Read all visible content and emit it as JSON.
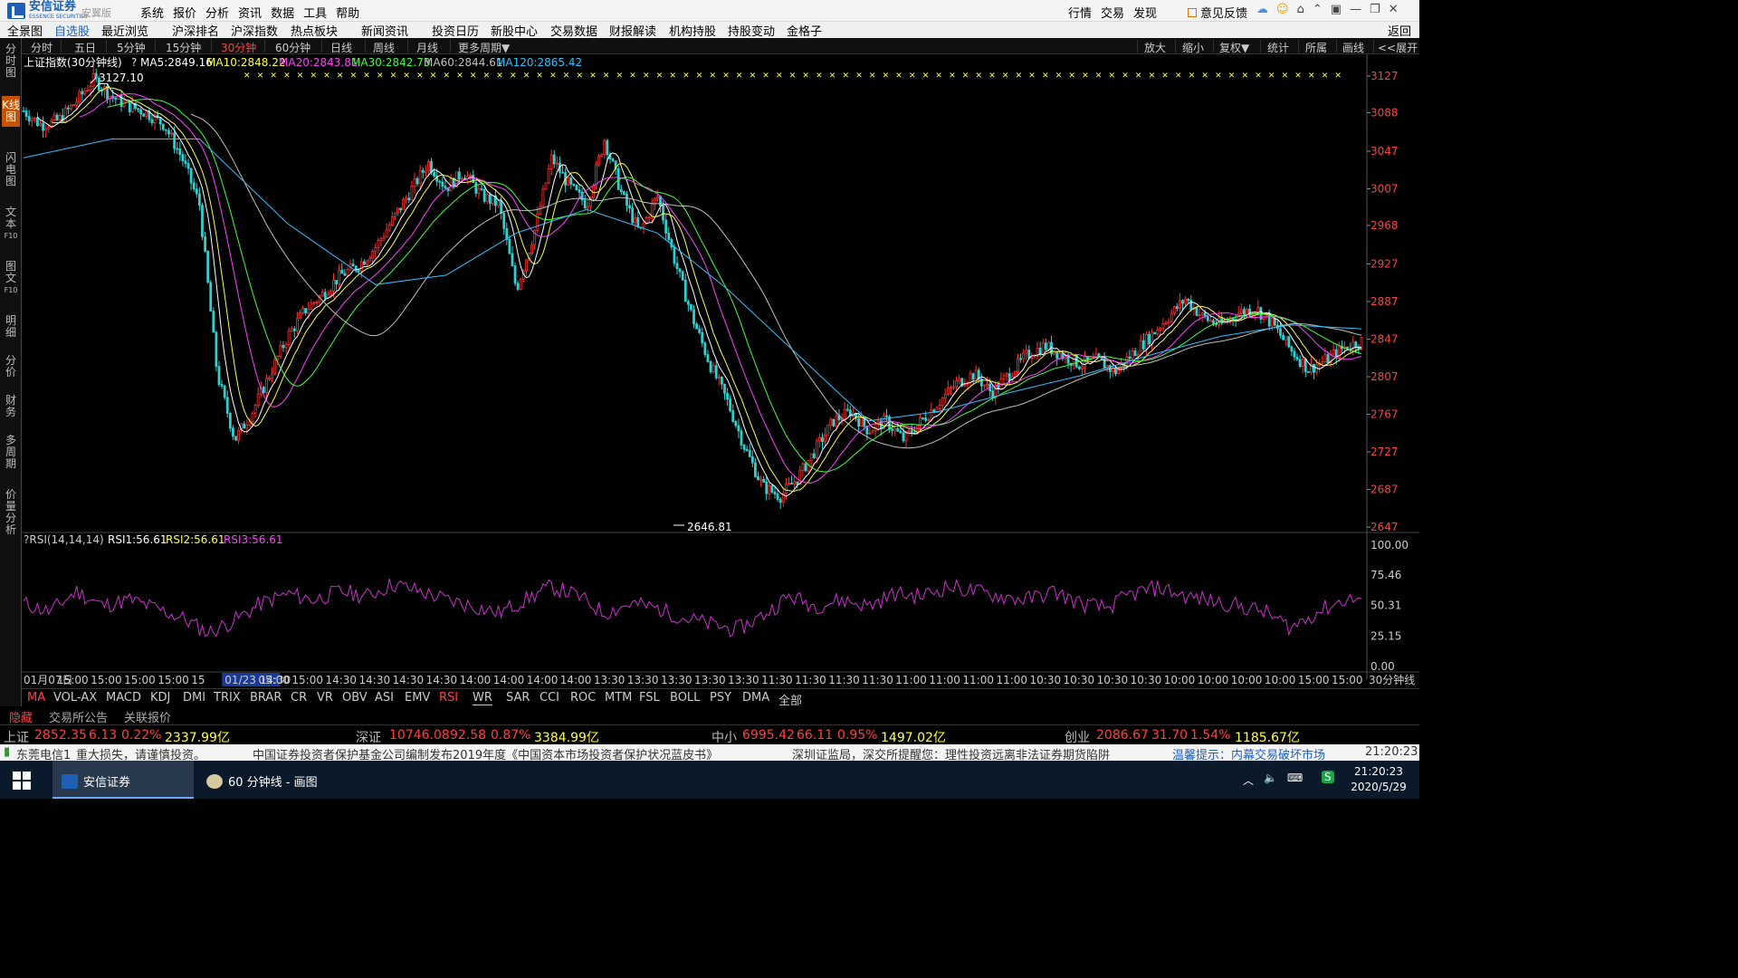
{
  "app": {
    "name": "安信证券",
    "name_en": "ESSENCE SECURITIES",
    "edition": "安翼版",
    "menu": [
      "系统",
      "报价",
      "分析",
      "资讯",
      "数据",
      "工具",
      "帮助"
    ],
    "right_menu": [
      "行情",
      "交易",
      "发现"
    ],
    "feedback": "意见反馈"
  },
  "nav": {
    "items": [
      "全景图",
      "自选股",
      "最近浏览",
      "沪深排名",
      "沪深指数",
      "热点板块",
      "新闻资讯",
      "投资日历",
      "新股中心",
      "交易数据",
      "财报解读",
      "机构持股",
      "持股变动",
      "金格子"
    ],
    "active": "自选股",
    "back": "返回"
  },
  "sidebar": [
    {
      "label": "分时图"
    },
    {
      "label": "K线图",
      "active": true
    },
    {
      "label": "闪电图"
    },
    {
      "label": "文本",
      "sub": "F10"
    },
    {
      "label": "图文",
      "sub": "F10"
    },
    {
      "label": "明细"
    },
    {
      "label": "分价"
    },
    {
      "label": "财务"
    },
    {
      "label": "多周期"
    },
    {
      "label": "价量分析"
    }
  ],
  "periods": [
    "分时",
    "五日",
    "5分钟",
    "15分钟",
    "30分钟",
    "60分钟",
    "日线",
    "周线",
    "月线",
    "更多周期▼"
  ],
  "active_period": "30分钟",
  "tools": [
    "放大",
    "缩小",
    "复权▼",
    "统计",
    "所属",
    "画线",
    "<<展开"
  ],
  "main_legend": {
    "title": "上证指数(30分钟线)",
    "help": "?",
    "ma5": "MA5:2849.16",
    "ma10": "MA10:2848.22",
    "ma20": "MA20:2843.81",
    "ma30": "MA30:2842.73",
    "ma60": "MA60:2844.61",
    "ma120": "MA120:2865.42"
  },
  "rsi_legend": {
    "title": "?RSI(14,14,14)",
    "rsi1": "RSI1:56.61",
    "rsi2": "RSI2:56.61",
    "rsi3": "RSI3:56.61"
  },
  "colors": {
    "up": "#ff3030",
    "down": "#30d0d0",
    "ma5": "#ffffff",
    "ma10": "#ffff40",
    "ma20": "#ff40ff",
    "ma30": "#40ff40",
    "ma60": "#c0c0c0",
    "ma120": "#30c0ff",
    "rsi": "#cc30cc"
  },
  "chart_data": {
    "type": "candlestick",
    "period": "30分钟线",
    "y_ticks": [
      3127,
      3088,
      3047,
      3007,
      2968,
      2927,
      2887,
      2847,
      2807,
      2767,
      2727,
      2687,
      2647
    ],
    "ylim": [
      2647,
      3127
    ],
    "max_label": "3127.10",
    "min_label": "2646.81",
    "x_labels": [
      "01月07日",
      "15:00",
      "15:00",
      "15:00",
      "15:00",
      "15",
      "01/23 14:30",
      "05:00",
      "15:00",
      "14:30",
      "14:30",
      "14:30",
      "14:30",
      "14:00",
      "14:00",
      "14:00",
      "14:00",
      "13:30",
      "13:30",
      "13:30",
      "13:30",
      "13:30",
      "11:30",
      "11:30",
      "11:30",
      "11:30",
      "11:00",
      "11:00",
      "11:00",
      "11:00",
      "10:30",
      "10:30",
      "10:30",
      "10:30",
      "10:00",
      "10:00",
      "10:00",
      "10:00",
      "15:00",
      "15:00"
    ],
    "x_suffix": "30分钟线",
    "price_path": [
      [
        0,
        3090
      ],
      [
        2,
        3075
      ],
      [
        4,
        3080
      ],
      [
        6,
        3100
      ],
      [
        8,
        3124
      ],
      [
        10,
        3105
      ],
      [
        12,
        3095
      ],
      [
        14,
        3088
      ],
      [
        16,
        3075
      ],
      [
        18,
        3040
      ],
      [
        20,
        2990
      ],
      [
        22,
        2810
      ],
      [
        24,
        2740
      ],
      [
        26,
        2770
      ],
      [
        28,
        2810
      ],
      [
        30,
        2850
      ],
      [
        32,
        2878
      ],
      [
        34,
        2895
      ],
      [
        36,
        2915
      ],
      [
        38,
        2925
      ],
      [
        40,
        2945
      ],
      [
        42,
        2975
      ],
      [
        44,
        3005
      ],
      [
        46,
        3035
      ],
      [
        48,
        3008
      ],
      [
        50,
        3025
      ],
      [
        52,
        3000
      ],
      [
        54,
        2990
      ],
      [
        56,
        2900
      ],
      [
        58,
        2960
      ],
      [
        60,
        3040
      ],
      [
        62,
        3010
      ],
      [
        64,
        2990
      ],
      [
        66,
        3060
      ],
      [
        68,
        3000
      ],
      [
        70,
        2960
      ],
      [
        72,
        3000
      ],
      [
        74,
        2930
      ],
      [
        76,
        2870
      ],
      [
        78,
        2820
      ],
      [
        80,
        2780
      ],
      [
        82,
        2730
      ],
      [
        84,
        2690
      ],
      [
        86,
        2680
      ],
      [
        88,
        2700
      ],
      [
        90,
        2730
      ],
      [
        92,
        2760
      ],
      [
        94,
        2770
      ],
      [
        96,
        2750
      ],
      [
        98,
        2760
      ],
      [
        100,
        2740
      ],
      [
        102,
        2760
      ],
      [
        104,
        2780
      ],
      [
        106,
        2800
      ],
      [
        108,
        2810
      ],
      [
        110,
        2790
      ],
      [
        112,
        2810
      ],
      [
        114,
        2830
      ],
      [
        116,
        2840
      ],
      [
        118,
        2830
      ],
      [
        120,
        2820
      ],
      [
        122,
        2825
      ],
      [
        124,
        2812
      ],
      [
        126,
        2832
      ],
      [
        128,
        2850
      ],
      [
        130,
        2870
      ],
      [
        132,
        2890
      ],
      [
        134,
        2870
      ],
      [
        136,
        2862
      ],
      [
        138,
        2875
      ],
      [
        140,
        2880
      ],
      [
        142,
        2862
      ],
      [
        144,
        2835
      ],
      [
        146,
        2815
      ],
      [
        148,
        2825
      ],
      [
        150,
        2838
      ],
      [
        152,
        2845
      ]
    ],
    "ma120_path": [
      [
        0,
        3040
      ],
      [
        10,
        3060
      ],
      [
        20,
        3060
      ],
      [
        30,
        2970
      ],
      [
        40,
        2905
      ],
      [
        48,
        2915
      ],
      [
        56,
        2960
      ],
      [
        64,
        2985
      ],
      [
        72,
        2960
      ],
      [
        80,
        2900
      ],
      [
        88,
        2830
      ],
      [
        96,
        2760
      ],
      [
        104,
        2770
      ],
      [
        112,
        2790
      ],
      [
        120,
        2808
      ],
      [
        128,
        2830
      ],
      [
        136,
        2850
      ],
      [
        144,
        2862
      ],
      [
        152,
        2858
      ]
    ],
    "rsi_yticks": [
      100.0,
      75.46,
      50.31,
      25.15,
      0.0
    ],
    "rsi_ylim": [
      0,
      100
    ],
    "rsi_path": [
      [
        0,
        52
      ],
      [
        3,
        45
      ],
      [
        6,
        62
      ],
      [
        9,
        50
      ],
      [
        12,
        55
      ],
      [
        15,
        48
      ],
      [
        18,
        40
      ],
      [
        21,
        28
      ],
      [
        24,
        38
      ],
      [
        27,
        52
      ],
      [
        30,
        60
      ],
      [
        33,
        55
      ],
      [
        36,
        62
      ],
      [
        39,
        58
      ],
      [
        42,
        68
      ],
      [
        45,
        62
      ],
      [
        48,
        55
      ],
      [
        51,
        50
      ],
      [
        54,
        44
      ],
      [
        57,
        55
      ],
      [
        60,
        66
      ],
      [
        63,
        58
      ],
      [
        66,
        44
      ],
      [
        69,
        52
      ],
      [
        72,
        48
      ],
      [
        75,
        40
      ],
      [
        78,
        35
      ],
      [
        81,
        30
      ],
      [
        84,
        42
      ],
      [
        87,
        58
      ],
      [
        90,
        50
      ],
      [
        93,
        55
      ],
      [
        96,
        50
      ],
      [
        99,
        60
      ],
      [
        102,
        58
      ],
      [
        105,
        66
      ],
      [
        108,
        62
      ],
      [
        111,
        58
      ],
      [
        114,
        55
      ],
      [
        117,
        62
      ],
      [
        120,
        52
      ],
      [
        123,
        48
      ],
      [
        126,
        60
      ],
      [
        129,
        65
      ],
      [
        132,
        58
      ],
      [
        135,
        54
      ],
      [
        138,
        50
      ],
      [
        141,
        45
      ],
      [
        144,
        32
      ],
      [
        147,
        45
      ],
      [
        150,
        55
      ],
      [
        152,
        56
      ]
    ]
  },
  "indicator_tabs": [
    "MA",
    "VOL-AX",
    "MACD",
    "KDJ",
    "DMI",
    "TRIX",
    "BRAR",
    "CR",
    "VR",
    "OBV",
    "ASI",
    "EMV",
    "RSI",
    "WR",
    "SAR",
    "CCI",
    "ROC",
    "MTM",
    "FSL",
    "BOLL",
    "PSY",
    "DMA",
    "全部"
  ],
  "active_tab": "MA",
  "active_tab2": "RSI",
  "info": {
    "hide": "隐藏",
    "notice": "交易所公告",
    "related": "关联报价"
  },
  "indices": [
    {
      "name": "上证",
      "price": "2852.35",
      "chg": "6.13",
      "pct": "0.22%",
      "turn": "2337.99亿"
    },
    {
      "name": "深证",
      "price": "10746.08",
      "chg": "92.58",
      "pct": "0.87%",
      "turn": "3384.99亿"
    },
    {
      "name": "中小",
      "price": "6995.42",
      "chg": "66.11",
      "pct": "0.95%",
      "turn": "1497.02亿"
    },
    {
      "name": "创业",
      "price": "2086.67",
      "chg": "31.70",
      "pct": "1.54%",
      "turn": "1185.67亿"
    }
  ],
  "ticker": {
    "left": "东莞电信1",
    "warn": "重大损失，请谨慎投资。",
    "news1": "中国证券投资者保护基金公司编制发布2019年度《中国资本市场投资者保护状况蓝皮书》",
    "news2": "深圳证监局，深交所提醒您：理性投资远离非法证券期货陷阱",
    "tip": "温馨提示：内幕交易破坏市场",
    "time": "21:20:23"
  },
  "taskbar": {
    "items": [
      "安信证券",
      "60 分钟线 - 画图"
    ],
    "time": "21:20:23",
    "date": "2020/5/29"
  }
}
